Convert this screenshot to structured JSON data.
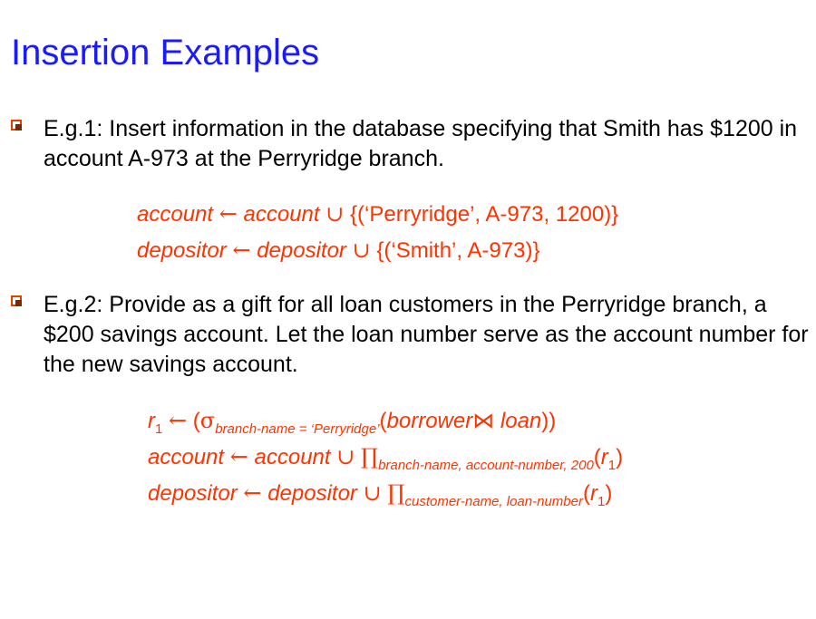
{
  "slide": {
    "title": "Insertion Examples",
    "colors": {
      "title": "#1a1aff",
      "formula": "#ff3300",
      "text": "#000000",
      "bullet": "#e04000"
    },
    "bullets": [
      {
        "icon": "square-bullet-icon",
        "text": "E.g.1: Insert information in the database specifying that Smith has $1200 in account A-973 at the Perryridge branch.",
        "formulas": [
          {
            "lhs": "account",
            "arrow": "←",
            "rel": "account",
            "union": "∪",
            "tail": " {(‘Perryridge’, A-973, 1200)}"
          },
          {
            "lhs": "depositor",
            "arrow": "←",
            "rel": "depositor",
            "union": "∪",
            "tail": " {(‘Smith’, A-973)}"
          }
        ]
      },
      {
        "icon": "square-bullet-icon",
        "text": "E.g.2: Provide as a gift for all loan customers in the Perryridge branch, a $200 savings account. Let the loan number serve as the account number for the new savings account.",
        "formulas": [
          {
            "r": "r",
            "rsub": "1",
            "arrow": "←",
            "open": " (",
            "sigma": "σ",
            "cond": "branch-name = ‘Perryridge’",
            "lp": "(",
            "rel1": "borrower",
            "join": "⋈",
            "rel2": " loan",
            "rp": "))"
          },
          {
            "lhs": "account",
            "arrow": "←",
            "rel": "account",
            "union": "∪",
            "pi": "∏",
            "attrs": "branch-name, account-number, 200",
            "lp": "(",
            "r": "r",
            "rsub": "1",
            "rp": ")"
          },
          {
            "lhs": "depositor",
            "arrow": "←",
            "rel": "depositor",
            "union": "∪",
            "pi": "∏",
            "attrs": "customer-name, loan-number",
            "lp": "(",
            "r": "r",
            "rsub": "1",
            "rp": ")"
          }
        ]
      }
    ]
  }
}
